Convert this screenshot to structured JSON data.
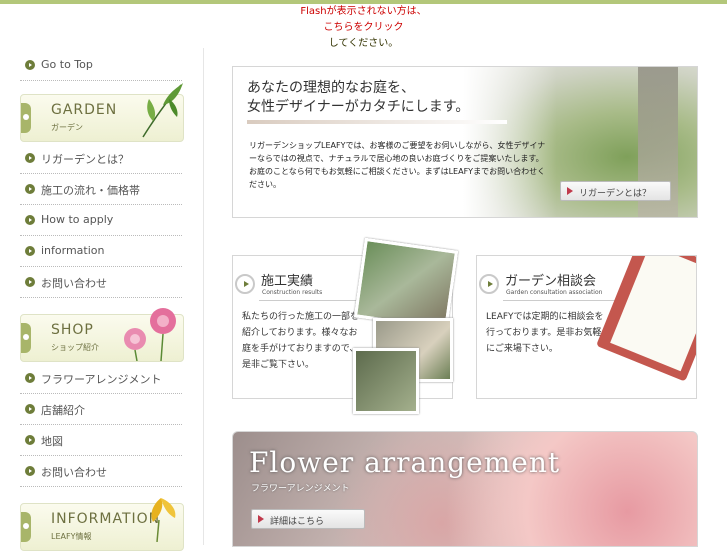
{
  "flash_notice": {
    "line1": "Flashが表示されない方は、",
    "line2": "こちらをクリック",
    "line3": "してください。"
  },
  "sidebar": {
    "go_to_top": "Go to Top",
    "garden_banner": {
      "en": "GARDEN",
      "jp": "ガーデン"
    },
    "garden_items": [
      "リガーデンとは？",
      "施工の流れ・価格帯",
      "How to apply",
      "information",
      "お問い合わせ"
    ],
    "shop_banner": {
      "en": "SHOP",
      "jp": "ショップ紹介"
    },
    "shop_items": [
      "フラワーアレンジメント",
      "店舗紹介",
      "地図",
      "お問い合わせ"
    ],
    "info_banner": {
      "en": "INFORMATION",
      "jp": "LEAFY情報"
    }
  },
  "hero": {
    "headline1": "あなたの理想的なお庭を、",
    "headline2": "女性デザイナーがカタチにします。",
    "body": "リガーデンショップLEAFYでは、お客様のご要望をお伺いしながら、女性デザイナーならではの視点で、ナチュラルで居心地の良いお庭づくりをご提案いたします。お庭のことなら何でもお気軽にご相談ください。まずはLEAFYまでお問い合わせください。",
    "button": "リガーデンとは？"
  },
  "cards": [
    {
      "title": "施工実績",
      "subtitle": "Construction results",
      "text": "私たちの行った施工の一部を紹介しております。様々なお庭を手がけておりますので、是非ご覧下さい。"
    },
    {
      "title": "ガーデン相談会",
      "subtitle": "Garden consultation association",
      "text": "LEAFYでは定期的に相談会を行っております。是非お気軽にご来場下さい。"
    }
  ],
  "flower": {
    "title": "Flower arrangement",
    "subtitle": "フラワーアレンジメント",
    "button": "詳細はこちら"
  },
  "colors": {
    "accent_green": "#6e7d3a",
    "top_bar": "#b3c77a",
    "notice_red": "#cc0000"
  }
}
